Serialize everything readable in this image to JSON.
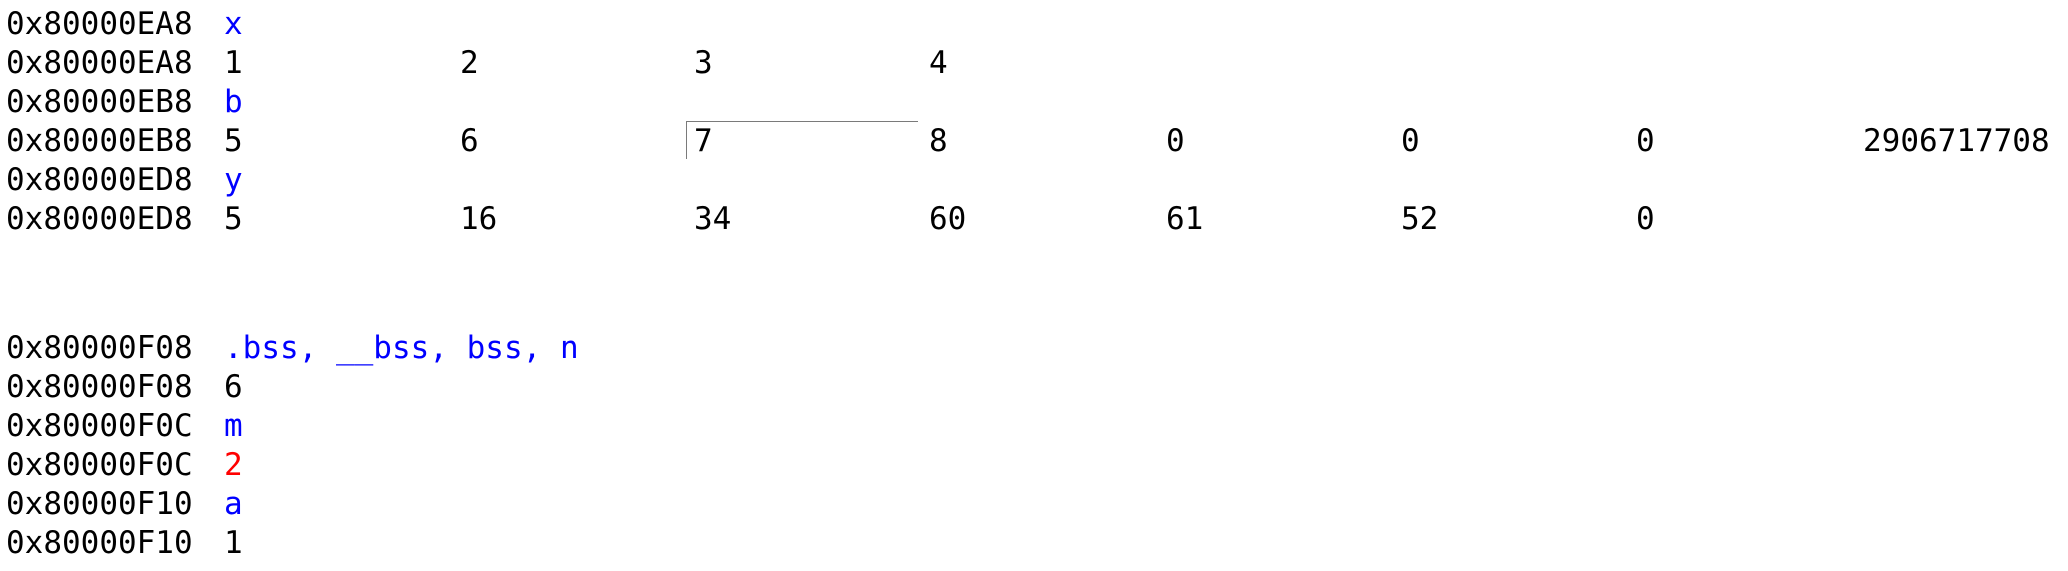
{
  "theme": {
    "background": "#ffffff",
    "text": "#000000",
    "label_color": "#0000ff",
    "changed_value_color": "#ff0000"
  },
  "rows": [
    {
      "addr": "0x80000EA8",
      "label": "x"
    },
    {
      "addr": "0x80000EA8",
      "values": [
        "1",
        "2",
        "3",
        "4"
      ]
    },
    {
      "addr": "0x80000EB8",
      "label": "b"
    },
    {
      "addr": "0x80000EB8",
      "values": [
        "5",
        "6",
        "7",
        "8",
        "0",
        "0",
        "0",
        "2906717708"
      ]
    },
    {
      "addr": "0x80000ED8",
      "label": "y"
    },
    {
      "addr": "0x80000ED8",
      "values": [
        "5",
        "16",
        "34",
        "60",
        "61",
        "52",
        "0"
      ]
    },
    {
      "addr": "0x80000F08",
      "label": ".bss, __bss, bss, n"
    },
    {
      "addr": "0x80000F08",
      "values": [
        "6"
      ]
    },
    {
      "addr": "0x80000F0C",
      "label": "m"
    },
    {
      "addr": "0x80000F0C",
      "values": [
        "2"
      ]
    },
    {
      "addr": "0x80000F10",
      "label": "a"
    },
    {
      "addr": "0x80000F10",
      "values": [
        "1"
      ]
    }
  ]
}
